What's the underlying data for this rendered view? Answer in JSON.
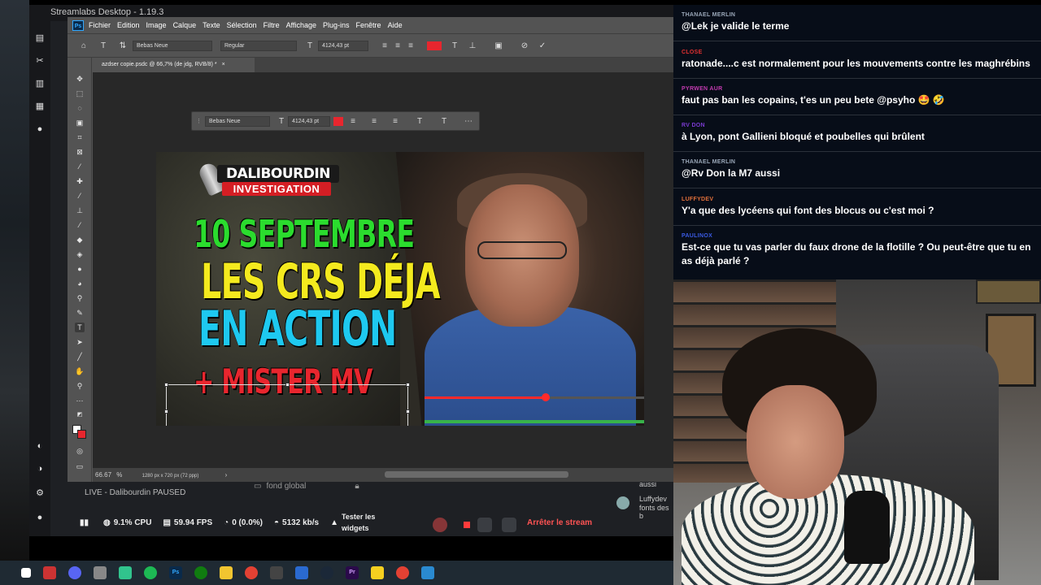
{
  "streamlabs": {
    "title": "Streamlabs Desktop - 1.19.3",
    "live_label": "LIVE - Dalibourdin PAUSED",
    "cpu": "9.1% CPU",
    "fps": "59.94 FPS",
    "dropped": "0 (0.0%)",
    "bitrate": "5132 kb/s",
    "test_widgets": "Tester les widgets",
    "stop_stream": "Arrêter le stream",
    "source_label": "fond global",
    "side_chat_user": "Luffydev",
    "side_chat_text": "fonts des b",
    "side_chat_prev": "aussi"
  },
  "photoshop": {
    "menu": [
      "Fichier",
      "Edition",
      "Image",
      "Calque",
      "Texte",
      "Sélection",
      "Filtre",
      "Affichage",
      "Plug-ins",
      "Fenêtre",
      "Aide"
    ],
    "font_family": "Bebas Neue",
    "font_style": "Regular",
    "font_size": "4124,43 pt",
    "tab_title": "azdser copie.psdc @ 66,7% (de jdg, RVB/8) *",
    "zoom": "66.67",
    "doc_size": "1280 px x 720 px (72 ppp)",
    "float_font": "Bebas Neue",
    "float_size": "4124,43 pt",
    "colors": {
      "text_swatch": "#e8262e"
    }
  },
  "thumbnail": {
    "logo_top": "DALIBOURDIN",
    "logo_bottom": "INVESTIGATION",
    "line1": "10 SEPTEMBRE",
    "line2": "LES CRS DÉJA",
    "line3": "EN ACTION",
    "line4": "+ MISTER MV",
    "colors": {
      "line1": "#2bdc2e",
      "line2": "#f4ea1e",
      "line3": "#1ec9f0",
      "line4": "#e8262e"
    }
  },
  "chat": [
    {
      "user": "THANAEL MERLIN",
      "color": "#9aa7b8",
      "text": "@Lek je valide le terme"
    },
    {
      "user": "CLOSE",
      "color": "#e23030",
      "text": "ratonade....c est normalement pour les mouvements contre les maghrébins"
    },
    {
      "user": "PYRWEN AUR",
      "color": "#c23ab0",
      "text": "faut pas ban les copains, t'es un peu bete @psyho 🤩 🤣"
    },
    {
      "user": "RV DON",
      "color": "#7a3ad0",
      "text": "à Lyon, pont Gallieni bloqué et poubelles qui brûlent"
    },
    {
      "user": "THANAEL MERLIN",
      "color": "#9aa7b8",
      "text": "@Rv Don la M7 aussi"
    },
    {
      "user": "LUFFYDEV",
      "color": "#e2703a",
      "text": "Y'a que des lycéens qui font des blocus ou c'est moi ?"
    },
    {
      "user": "PAULINOX",
      "color": "#3a5ae2",
      "text": "Est-ce que tu vas parler du faux drone de la flotille ? Ou peut-être que tu en as déjà parlé ?"
    }
  ]
}
